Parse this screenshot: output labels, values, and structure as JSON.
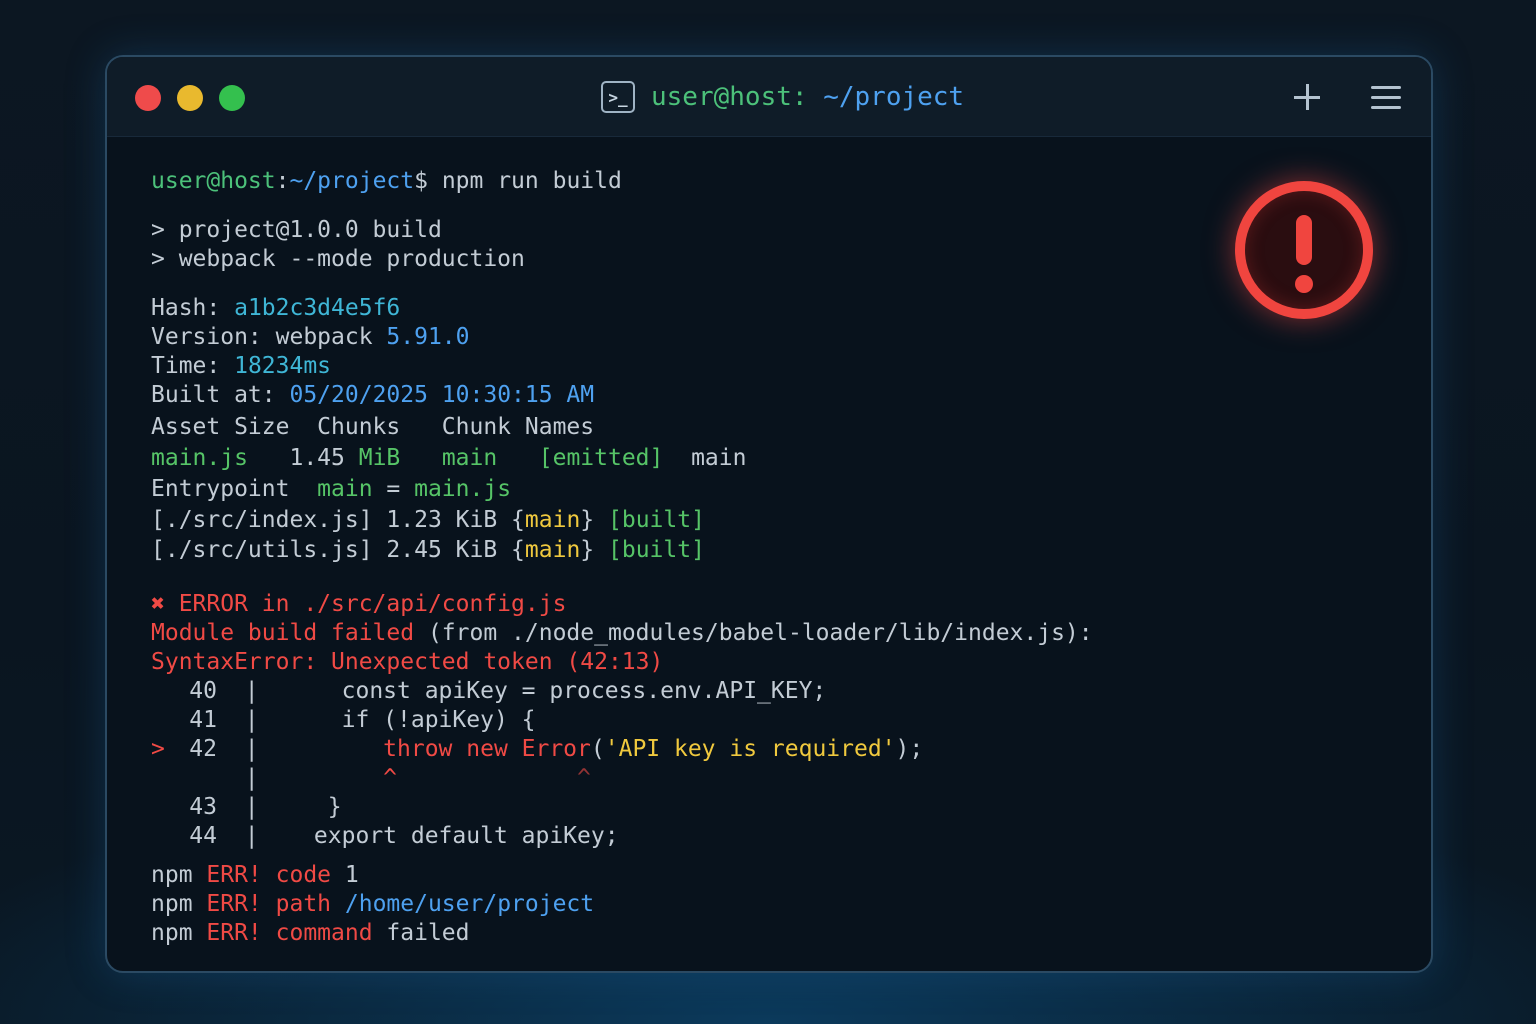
{
  "window": {
    "title_user": "user@host:",
    "title_path": " ~/project",
    "terminal_icon": ">_",
    "icons": [
      "terminal-icon",
      "plus-icon",
      "menu-icon",
      "alert-icon"
    ],
    "colors": {
      "close": "#ef4b4b",
      "minimize": "#e9b92e",
      "maximize": "#34c04e",
      "error": "#f04a45"
    }
  },
  "prompt": {
    "user": "user@host",
    "sep": ":",
    "path": "~/project",
    "dollar": "$",
    "command": " npm run build"
  },
  "script": [
    "> project@1.0.0 build",
    "> webpack --mode production"
  ],
  "info": {
    "hash_label": "Hash: ",
    "hash": "a1b2c3d4e5f6",
    "version_label": "Version: webpack ",
    "version": "5.91.0",
    "time_label": "Time: ",
    "time": "18234ms",
    "built_label": "Built at: ",
    "built": "05/20/2025 10:30:15 AM"
  },
  "assets": {
    "header": "Asset Size  Chunks   Chunk Names",
    "row": {
      "asset": "main.js",
      "size_num": "   1.45 ",
      "size_unit": "MiB",
      "chunk": "main",
      "status": "[emitted]",
      "name": "main"
    },
    "entry": {
      "label": "Entrypoint  ",
      "name": "main",
      "eq": " = ",
      "file": "main.js"
    },
    "modules": [
      {
        "path": "[./src/index.js]",
        "size": " 1.23 KiB ",
        "chunk": "main",
        "status": "[built]"
      },
      {
        "path": "[./src/utils.js]",
        "size": " 2.45 KiB ",
        "chunk": "main",
        "status": "[built]"
      }
    ]
  },
  "error": {
    "line1": "✖ ERROR in ./src/api/config.js",
    "line2_red": "Module build failed",
    "line2_rest": " (from ./node_modules/babel-loader/lib/index.js):",
    "line3": "SyntaxError: Unexpected token (42:13)",
    "code": [
      {
        "marker": "",
        "num": "40",
        "text": "      const apiKey = process.env.API_KEY;"
      },
      {
        "marker": "",
        "num": "41",
        "text": "      if (!apiKey) {"
      },
      {
        "marker": ">",
        "num": "42",
        "pre": "         ",
        "kw": "throw new Error",
        "paren": "(",
        "str": "'API key is required'",
        "post": ");"
      },
      {
        "marker": "",
        "num": "",
        "caret1": "         ^",
        "caret2": "             ^"
      },
      {
        "marker": "",
        "num": "43",
        "text": "     }"
      },
      {
        "marker": "",
        "num": "44",
        "text": "    export default apiKey;"
      }
    ]
  },
  "npm_err": [
    {
      "prefix": "npm ",
      "tag": "ERR!",
      "key": " code",
      "value": " 1"
    },
    {
      "prefix": "npm ",
      "tag": "ERR!",
      "key": " path",
      "value": " /home/user/project"
    },
    {
      "prefix": "npm ",
      "tag": "ERR!",
      "key": " command",
      "value": " failed"
    }
  ]
}
